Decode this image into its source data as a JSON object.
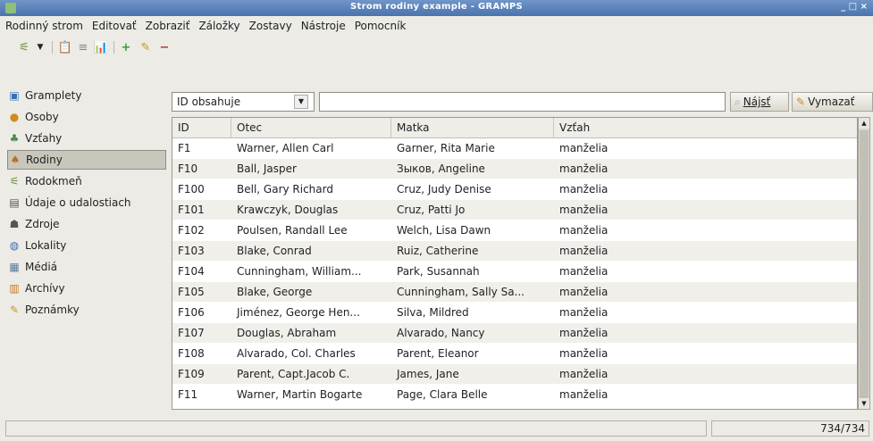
{
  "window": {
    "title": "Strom rodiny example - GRAMPS",
    "controls": "_ □ ×"
  },
  "menubar": [
    "Rodinný strom",
    "Editovať",
    "Zobraziť",
    "Záložky",
    "Zostavy",
    "Nástroje",
    "Pomocník"
  ],
  "sidebar": {
    "items": [
      {
        "label": "Gramplety",
        "icon": "gramplets-icon"
      },
      {
        "label": "Osoby",
        "icon": "person-icon"
      },
      {
        "label": "Vzťahy",
        "icon": "relationships-icon"
      },
      {
        "label": "Rodiny",
        "icon": "family-icon",
        "active": true
      },
      {
        "label": "Rodokmeň",
        "icon": "pedigree-icon"
      },
      {
        "label": "Údaje o udalostiach",
        "icon": "events-icon"
      },
      {
        "label": "Zdroje",
        "icon": "sources-icon"
      },
      {
        "label": "Lokality",
        "icon": "places-icon"
      },
      {
        "label": "Médiá",
        "icon": "media-icon"
      },
      {
        "label": "Archívy",
        "icon": "repositories-icon"
      },
      {
        "label": "Poznámky",
        "icon": "notes-icon"
      }
    ]
  },
  "search": {
    "filter": "ID obsahuje",
    "value": "",
    "find_button": "Nájsť",
    "clear_button": "Vymazať"
  },
  "table": {
    "columns": [
      "ID",
      "Otec",
      "Matka",
      "Vzťah"
    ],
    "rows": [
      [
        "F1",
        "Warner, Allen Carl",
        "Garner, Rita Marie",
        "manželia"
      ],
      [
        "F10",
        "Ball, Jasper",
        "Зыков, Angeline",
        "manželia"
      ],
      [
        "F100",
        "Bell, Gary Richard",
        "Cruz, Judy Denise",
        "manželia"
      ],
      [
        "F101",
        "Krawczyk, Douglas",
        "Cruz, Patti Jo",
        "manželia"
      ],
      [
        "F102",
        "Poulsen, Randall Lee",
        "Welch, Lisa Dawn",
        "manželia"
      ],
      [
        "F103",
        "Blake, Conrad",
        "Ruiz, Catherine",
        "manželia"
      ],
      [
        "F104",
        "Cunningham, William...",
        "Park, Susannah",
        "manželia"
      ],
      [
        "F105",
        "Blake, George",
        "Cunningham, Sally Sa...",
        "manželia"
      ],
      [
        "F106",
        "Jiménez, George Hen...",
        "Silva, Mildred",
        "manželia"
      ],
      [
        "F107",
        "Douglas, Abraham",
        "Alvarado, Nancy",
        "manželia"
      ],
      [
        "F108",
        "Alvarado, Col. Charles",
        "Parent, Eleanor",
        "manželia"
      ],
      [
        "F109",
        "Parent, Capt.Jacob C.",
        "James, Jane",
        "manželia"
      ],
      [
        "F11",
        "Warner, Martin Bogarte",
        "Page, Clara Belle",
        "manželia"
      ]
    ]
  },
  "status": {
    "left": "",
    "count": "734/734"
  },
  "colors": {
    "titlebar": "#5a80b9",
    "background": "#ecebe6",
    "row_alt": "#f0efea"
  }
}
